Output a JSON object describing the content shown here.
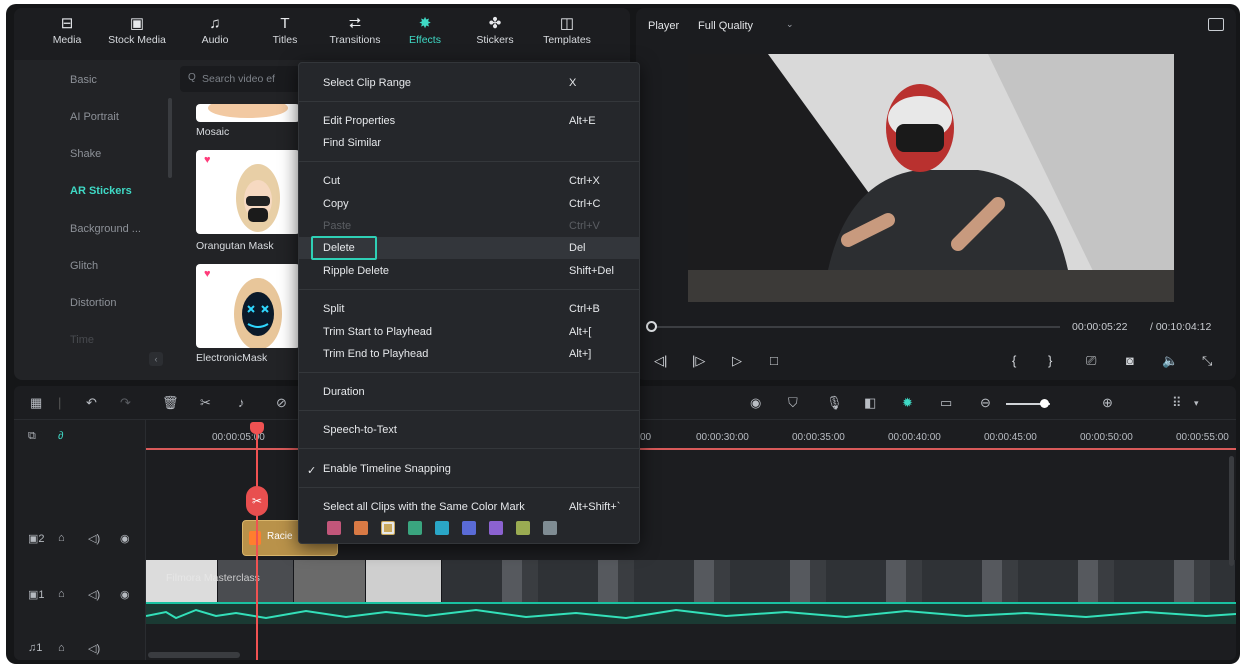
{
  "tabs": [
    {
      "label": "Media",
      "icon": "media-icon",
      "glyph": "⊟"
    },
    {
      "label": "Stock Media",
      "icon": "stock-media-icon",
      "glyph": "▣"
    },
    {
      "label": "Audio",
      "icon": "music-note-icon",
      "glyph": "♫"
    },
    {
      "label": "Titles",
      "icon": "text-icon",
      "glyph": "T"
    },
    {
      "label": "Transitions",
      "icon": "transition-icon",
      "glyph": "⮂"
    },
    {
      "label": "Effects",
      "icon": "sparkle-icon",
      "glyph": "✸"
    },
    {
      "label": "Stickers",
      "icon": "sticker-icon",
      "glyph": "✤"
    },
    {
      "label": "Templates",
      "icon": "template-icon",
      "glyph": "◫"
    }
  ],
  "active_tab": "Effects",
  "categories": [
    "Basic",
    "AI Portrait",
    "Shake",
    "AR Stickers",
    "Background ...",
    "Glitch",
    "Distortion",
    "Time"
  ],
  "active_category": "AR Stickers",
  "search": {
    "placeholder": "Search video ef"
  },
  "effects": [
    {
      "label": "Mosaic"
    },
    {
      "label": "Orangutan Mask"
    },
    {
      "label": "ElectronicMask"
    }
  ],
  "player": {
    "label": "Player",
    "quality": "Full Quality",
    "current_time": "00:00:05:22",
    "total_time": "/ 00:10:04:12",
    "progress": 0.01
  },
  "ruler_labels": [
    "00:00:05:00",
    "00",
    "00:00:30:00",
    "00:00:35:00",
    "00:00:40:00",
    "00:00:45:00",
    "00:00:50:00",
    "00:00:55:00"
  ],
  "sticker_clip": {
    "label": "Racie"
  },
  "video_clip": {
    "title": "Filmora Masterclass"
  },
  "menu": {
    "items": [
      {
        "label": "Select Clip Range",
        "shortcut": "X"
      },
      {
        "label": "Edit Properties",
        "shortcut": "Alt+E"
      },
      {
        "label": "Find Similar",
        "shortcut": ""
      },
      {
        "label": "Cut",
        "shortcut": "Ctrl+X"
      },
      {
        "label": "Copy",
        "shortcut": "Ctrl+C"
      },
      {
        "label": "Paste",
        "shortcut": "Ctrl+V"
      },
      {
        "label": "Delete",
        "shortcut": "Del"
      },
      {
        "label": "Ripple Delete",
        "shortcut": "Shift+Del"
      },
      {
        "label": "Split",
        "shortcut": "Ctrl+B"
      },
      {
        "label": "Trim Start to Playhead",
        "shortcut": "Alt+["
      },
      {
        "label": "Trim End to Playhead",
        "shortcut": "Alt+]"
      },
      {
        "label": "Duration",
        "shortcut": ""
      },
      {
        "label": "Speech-to-Text",
        "shortcut": ""
      },
      {
        "label": "Enable Timeline Snapping",
        "shortcut": ""
      },
      {
        "label": "Select all Clips with the Same Color Mark",
        "shortcut": "Alt+Shift+`"
      }
    ],
    "disabled": [
      "Paste"
    ],
    "highlighted": "Delete",
    "checked": "Enable Timeline Snapping",
    "color_marks": [
      "#c2567a",
      "#d97a45",
      "#c9a85c",
      "#3aa57f",
      "#2aa6c7",
      "#5a6bd6",
      "#8b62d0",
      "#9aab52",
      "#7f8c93"
    ],
    "selected_color": "#c9a85c"
  },
  "colors": {
    "accent": "#3fd9c5",
    "playhead": "#f05252",
    "audio_wave": "#19c2a1"
  }
}
